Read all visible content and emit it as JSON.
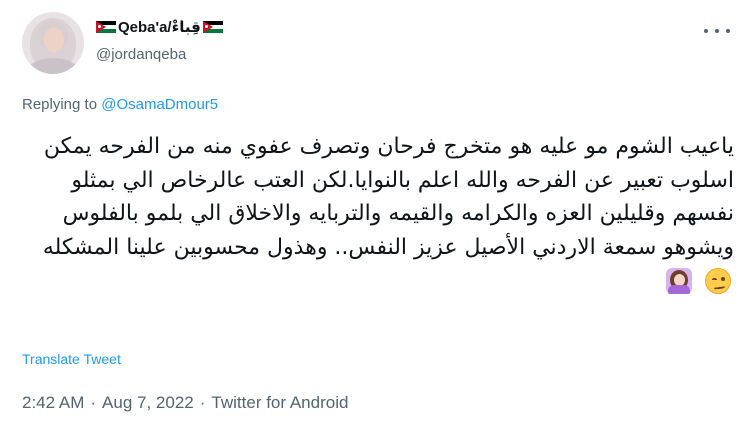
{
  "author": {
    "display_name": "Qeba'a/قِباءْ",
    "handle": "@jordanqeba"
  },
  "reply": {
    "prefix": "Replying to ",
    "mention": "@OsamaDmour5"
  },
  "tweet": {
    "text": "ياعيب الشوم مو عليه هو متخرج فرحان وتصرف عفوي منه من الفرحه يمكن اسلوب تعبير عن الفرحه والله اعلم بالنوايا.لكن العتب عالرخاص الي بمثلو نفسهم وقليلين العزه والكرامه والقيمه والتربايه والاخلاق الي بلمو بالفلوس ويشوهو سمعة الاردني الأصيل عزيز النفس.. وهذول محسوبين علينا المشكله",
    "emojis": [
      "woozy-face-emoji",
      "woman-facepalming-emoji"
    ]
  },
  "actions": {
    "translate_label": "Translate Tweet"
  },
  "meta": {
    "time": "2:42 AM",
    "sep1": "·",
    "date": "Aug 7, 2022",
    "sep2": "·",
    "source": "Twitter for Android"
  },
  "colors": {
    "accent": "#1d9bf0",
    "secondary_text": "#536471",
    "primary_text": "#0f1419"
  }
}
